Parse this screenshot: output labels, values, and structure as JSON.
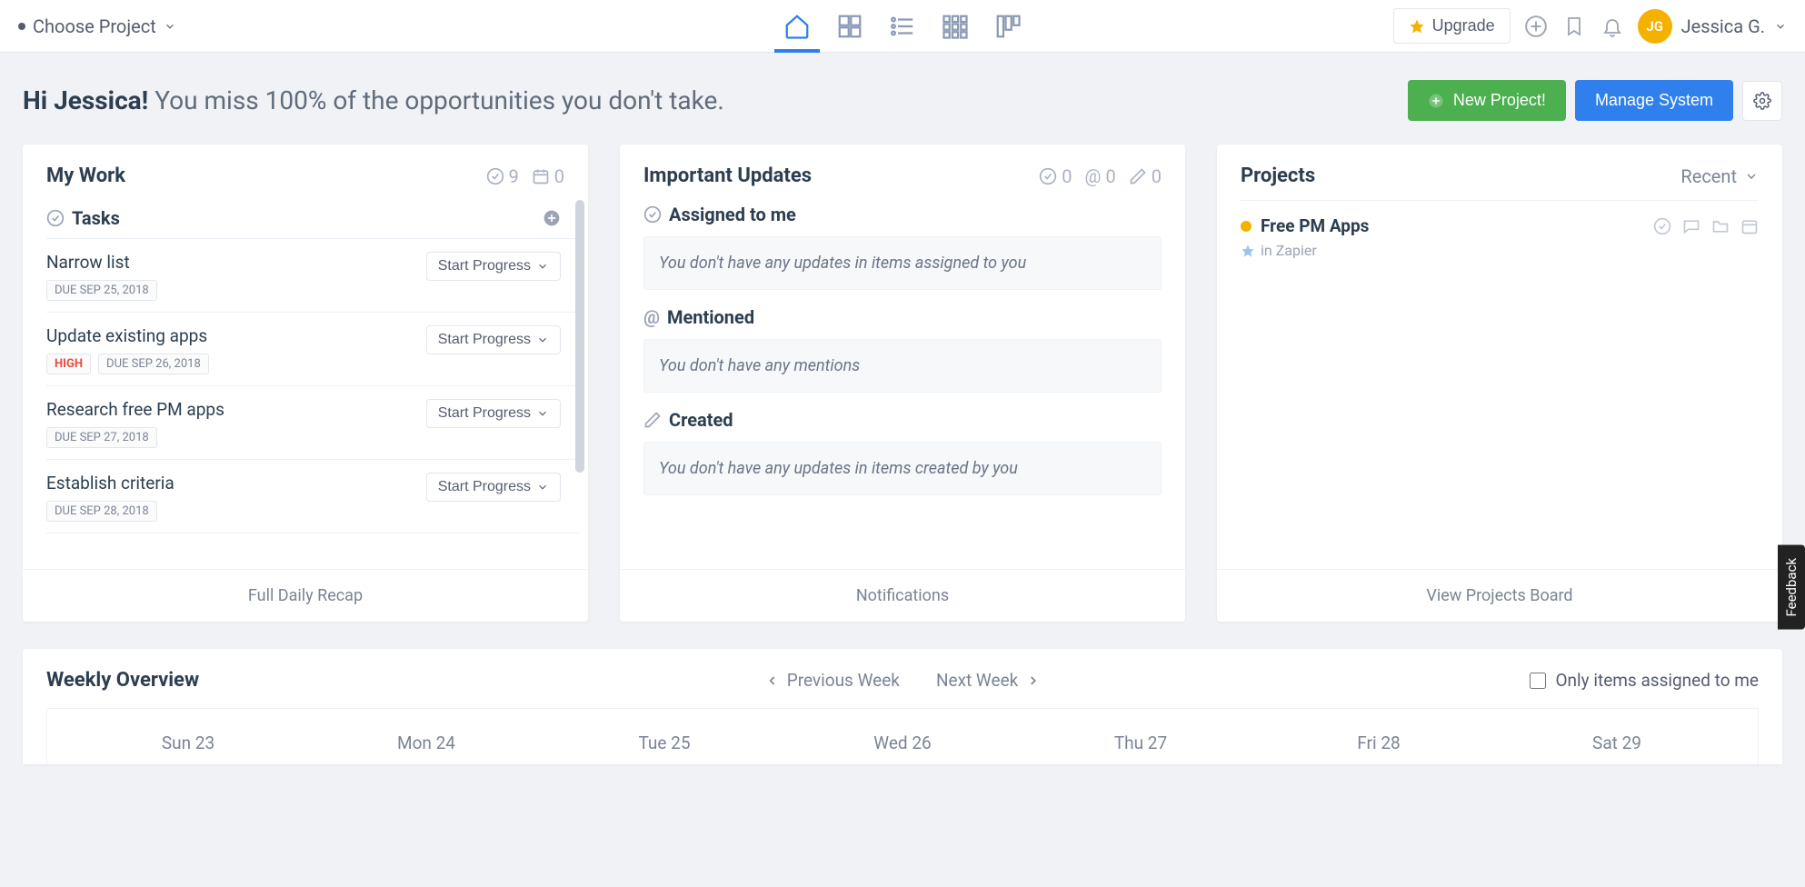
{
  "topnav": {
    "project_selector_label": "Choose Project",
    "upgrade_label": "Upgrade",
    "user_initials": "JG",
    "user_name": "Jessica G."
  },
  "greeting": {
    "name": "Hi Jessica!",
    "quote": "You miss 100% of the opportunities you don't take."
  },
  "actions": {
    "new_project_label": "New Project!",
    "manage_system_label": "Manage System"
  },
  "mywork": {
    "title": "My Work",
    "stat_check": "9",
    "stat_cal": "0",
    "section_tasks_label": "Tasks",
    "start_progress_label": "Start Progress",
    "footer": "Full Daily Recap",
    "tasks": [
      {
        "name": "Narrow list",
        "due": "DUE  SEP 25, 2018",
        "high": false
      },
      {
        "name": "Update existing apps",
        "due": "DUE  SEP 26, 2018",
        "high": true
      },
      {
        "name": "Research free PM apps",
        "due": "DUE  SEP 27, 2018",
        "high": false
      },
      {
        "name": "Establish criteria",
        "due": "DUE  SEP 28, 2018",
        "high": false
      }
    ],
    "high_label": "HIGH"
  },
  "updates": {
    "title": "Important Updates",
    "stat_check": "0",
    "stat_at": "0",
    "stat_pen": "0",
    "sections": {
      "assigned": {
        "label": "Assigned to me",
        "empty": "You don't have any updates in items assigned to you"
      },
      "mentioned": {
        "label": "Mentioned",
        "empty": "You don't have any mentions"
      },
      "created": {
        "label": "Created",
        "empty": "You don't have any updates in items created by you"
      }
    },
    "footer": "Notifications"
  },
  "projects": {
    "title": "Projects",
    "filter_label": "Recent",
    "item": {
      "name": "Free PM Apps",
      "workspace": "in Zapier"
    },
    "footer": "View Projects Board"
  },
  "weekly": {
    "title": "Weekly Overview",
    "prev_label": "Previous Week",
    "next_label": "Next Week",
    "checkbox_label": "Only items assigned to me",
    "days": [
      "Sun 23",
      "Mon 24",
      "Tue 25",
      "Wed 26",
      "Thu 27",
      "Fri 28",
      "Sat 29"
    ]
  },
  "feedback_label": "Feedback"
}
